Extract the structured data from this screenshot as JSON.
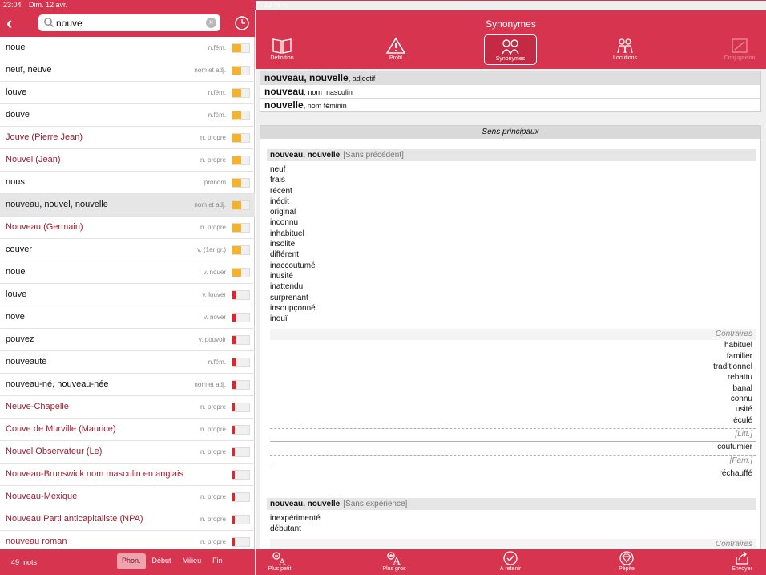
{
  "status": {
    "time": "23:04",
    "date": "Dim. 12 avr.",
    "battery": "22 %"
  },
  "search": {
    "query": "nouve"
  },
  "words": [
    {
      "word": "noue",
      "cat": "n.fém.",
      "proper": false,
      "level": 2,
      "color": "#f4b32a"
    },
    {
      "word": "neuf, neuve",
      "cat": "nom et adj.",
      "proper": false,
      "level": 2,
      "color": "#f4b32a"
    },
    {
      "word": "louve",
      "cat": "n.fém.",
      "proper": false,
      "level": 2,
      "color": "#f4b32a"
    },
    {
      "word": "douve",
      "cat": "n.fém.",
      "proper": false,
      "level": 2,
      "color": "#f4b32a"
    },
    {
      "word": "Jouve (Pierre Jean)",
      "cat": "n. propre",
      "proper": true,
      "level": 2,
      "color": "#f4b32a"
    },
    {
      "word": "Nouvel (Jean)",
      "cat": "n. propre",
      "proper": true,
      "level": 2,
      "color": "#f4b32a"
    },
    {
      "word": "nous",
      "cat": "pronom",
      "proper": false,
      "level": 2,
      "color": "#f4b32a"
    },
    {
      "word": "nouveau, nouvel, nouvelle",
      "cat": "nom et adj.",
      "proper": false,
      "level": 2,
      "color": "#f4b32a",
      "selected": true
    },
    {
      "word": "Nouveau (Germain)",
      "cat": "n. propre",
      "proper": true,
      "level": 2,
      "color": "#f4b32a"
    },
    {
      "word": "couver",
      "cat": "v. (1er gr.)",
      "proper": false,
      "level": 2,
      "color": "#f4b32a"
    },
    {
      "word": "noue",
      "cat": "v. nouer",
      "proper": false,
      "level": 2,
      "color": "#f4b32a"
    },
    {
      "word": "louve",
      "cat": "v. louver",
      "proper": false,
      "level": 1,
      "color": "#d9282f"
    },
    {
      "word": "nove",
      "cat": "v. nover",
      "proper": false,
      "level": 1,
      "color": "#d9282f"
    },
    {
      "word": "pouvez",
      "cat": "v. pouvoir",
      "proper": false,
      "level": 1,
      "color": "#d9282f"
    },
    {
      "word": "nouveauté",
      "cat": "n.fém.",
      "proper": false,
      "level": 1,
      "color": "#d9282f"
    },
    {
      "word": "nouveau-né, nouveau-née",
      "cat": "nom et adj.",
      "proper": false,
      "level": 1,
      "color": "#d9282f"
    },
    {
      "word": "Neuve-Chapelle",
      "cat": "n. propre",
      "proper": true,
      "level": 0.5,
      "color": "#d9282f"
    },
    {
      "word": "Couve de Murville (Maurice)",
      "cat": "n. propre",
      "proper": true,
      "level": 0.5,
      "color": "#d9282f"
    },
    {
      "word": "Nouvel Observateur (Le)",
      "cat": "n. propre",
      "proper": true,
      "level": 0.5,
      "color": "#d9282f"
    },
    {
      "word": "Nouveau-Brunswick nom masculin en anglais",
      "cat": "",
      "proper": true,
      "level": 0.5,
      "color": "#d9282f"
    },
    {
      "word": "Nouveau-Mexique",
      "cat": "n. propre",
      "proper": true,
      "level": 0.5,
      "color": "#d9282f"
    },
    {
      "word": "Nouveau Parti anticapitaliste (NPA)",
      "cat": "n. propre",
      "proper": true,
      "level": 0.5,
      "color": "#d9282f"
    },
    {
      "word": "nouveau roman",
      "cat": "n. propre",
      "proper": true,
      "level": 0.5,
      "color": "#d9282f"
    }
  ],
  "footer_left": {
    "count": "49 mots",
    "modes": [
      "Phon.",
      "Début",
      "Milieu",
      "Fin"
    ],
    "active_mode": 0
  },
  "header_right": {
    "title": "Synonymes"
  },
  "tabs": [
    {
      "label": "Définition",
      "icon": "book-icon"
    },
    {
      "label": "Profil",
      "icon": "warning-icon"
    },
    {
      "label": "Synonymes",
      "icon": "twins-icon",
      "active": true
    },
    {
      "label": "Locutions",
      "icon": "locutions-icon"
    },
    {
      "label": "Conjugaison",
      "icon": "conjugation-icon",
      "disabled": true
    }
  ],
  "entries": [
    {
      "headword": "nouveau, nouvelle",
      "pos": ", adjectif",
      "active": true
    },
    {
      "headword": "nouveau",
      "pos": ", nom masculin"
    },
    {
      "headword": "nouvelle",
      "pos": ", nom féminin"
    }
  ],
  "synonyms": {
    "section_title": "Sens principaux",
    "senses": [
      {
        "headword": "nouveau, nouvelle",
        "note": "[Sans précédent]",
        "words": [
          "neuf",
          "frais",
          "récent",
          "inédit",
          "original",
          "inconnu",
          "inhabituel",
          "insolite",
          "différent",
          "inaccoutumé",
          "inusité",
          "inattendu",
          "surprenant",
          "insoupçonné",
          "inouï"
        ],
        "contraires_label": "Contraires",
        "contraires": [
          "habituel",
          "familier",
          "traditionnel",
          "rebattu",
          "banal",
          "connu",
          "usité",
          "éculé"
        ],
        "registers": [
          {
            "label": "[Litt.]",
            "word": "coutumier"
          },
          {
            "label": "[Fam.]",
            "word": "réchauffé"
          }
        ]
      },
      {
        "headword": "nouveau, nouvelle",
        "note": "[Sans expérience]",
        "words": [
          "inexpérimenté",
          "débutant"
        ],
        "contraires_label": "Contraires"
      }
    ]
  },
  "footer_right": [
    {
      "label": "Plus petit",
      "icon": "text-smaller-icon"
    },
    {
      "label": "Plus gros",
      "icon": "text-larger-icon"
    },
    {
      "label": "À retenir",
      "icon": "checkmark-icon"
    },
    {
      "label": "Pépite",
      "icon": "gem-icon"
    },
    {
      "label": "Envoyer",
      "icon": "share-icon"
    }
  ]
}
